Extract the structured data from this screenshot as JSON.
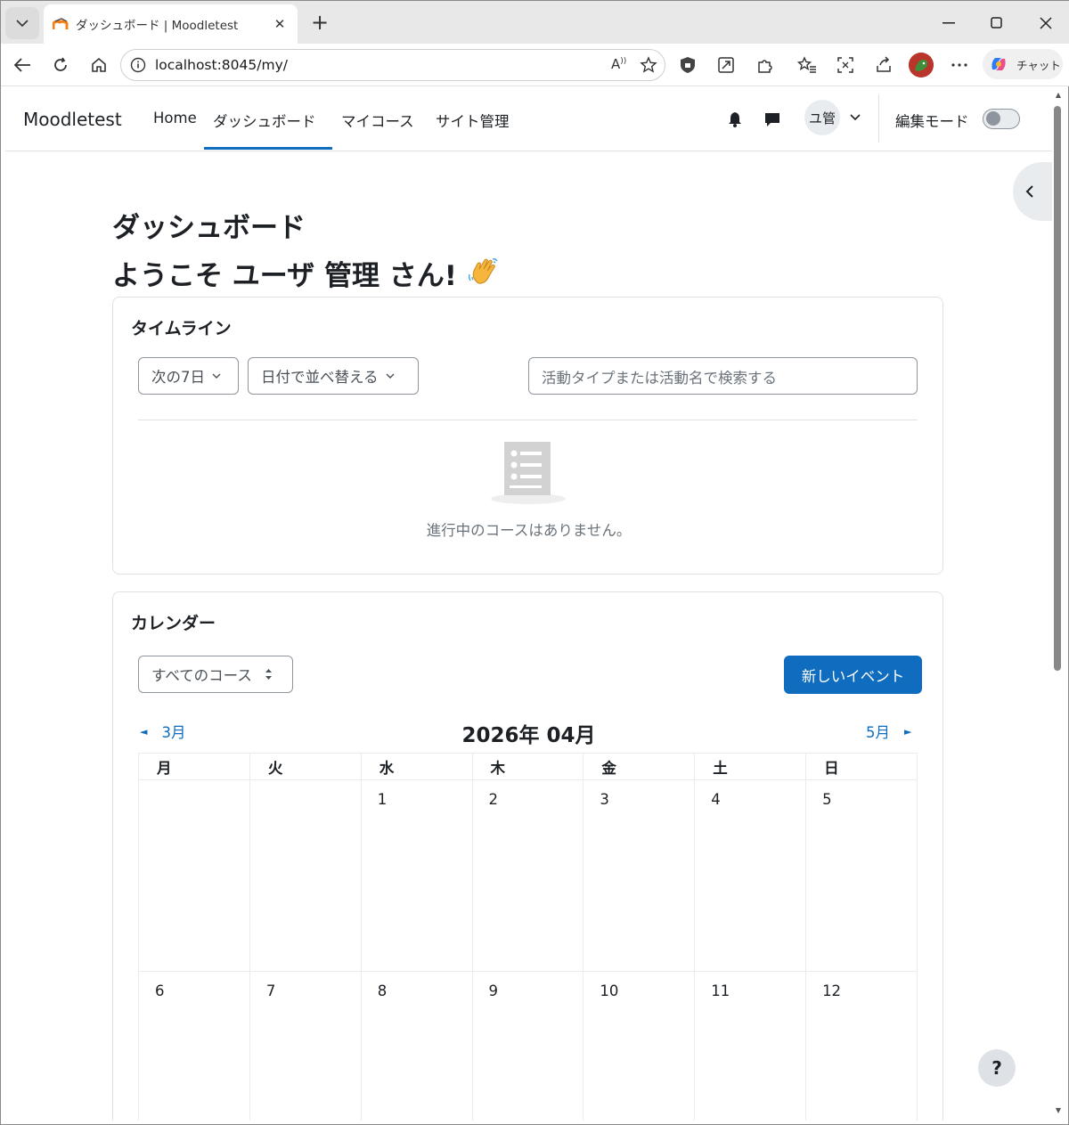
{
  "browser": {
    "tab_title": "ダッシュボード | Moodletest",
    "url": "localhost:8045/my/",
    "copilot_label": "チャット"
  },
  "navbar": {
    "brand": "Moodletest",
    "links": [
      "Home",
      "ダッシュボード",
      "マイコース",
      "サイト管理"
    ],
    "active_link": "ダッシュボード",
    "user_initials": "ユ管",
    "edit_mode_label": "編集モード",
    "edit_mode_on": false
  },
  "page": {
    "title": "ダッシュボード",
    "welcome": "ようこそ ユーザ 管理 さん!"
  },
  "timeline": {
    "title": "タイムライン",
    "filter_days": "次の7日",
    "sort": "日付で並べ替える",
    "search_placeholder": "活動タイプまたは活動名で検索する",
    "empty_message": "進行中のコースはありません。"
  },
  "calendar": {
    "title": "カレンダー",
    "course_filter": "すべてのコース",
    "new_event": "新しいイベント",
    "prev_month": "3月",
    "next_month": "5月",
    "current_month": "2026年 04月",
    "weekdays": [
      "月",
      "火",
      "水",
      "木",
      "金",
      "土",
      "日"
    ],
    "weeks": [
      [
        "",
        "",
        "1",
        "2",
        "3",
        "4",
        "5"
      ],
      [
        "6",
        "7",
        "8",
        "9",
        "10",
        "11",
        "12"
      ]
    ]
  },
  "colors": {
    "primary": "#0f6cbf",
    "border": "#dee2e6",
    "muted_text": "#6a737b"
  },
  "help_label": "?"
}
